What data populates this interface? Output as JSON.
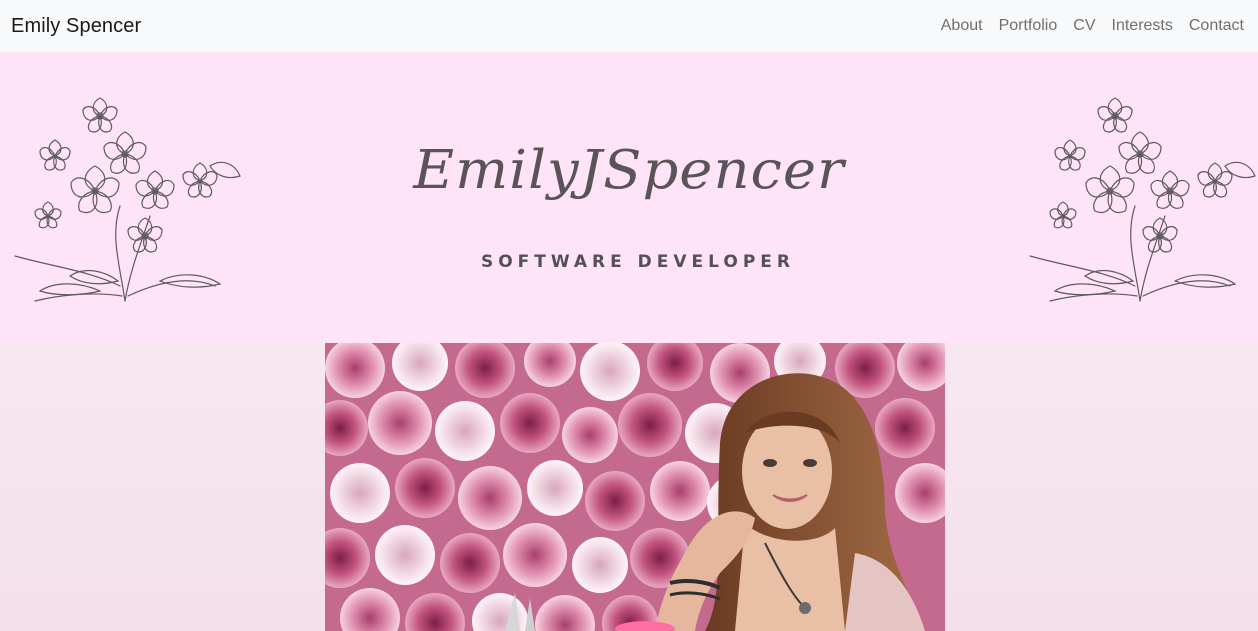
{
  "navbar": {
    "brand": "Emily Spencer",
    "links": [
      "About",
      "Portfolio",
      "CV",
      "Interests",
      "Contact"
    ]
  },
  "header": {
    "title": "EmilyJSpencer",
    "subtitle": "SOFTWARE DEVELOPER"
  },
  "colors": {
    "navbar_bg": "#f8f9fa",
    "banner_bg": "#ffe4f8",
    "page_bg": "#f7e6ee",
    "text_dark": "#5a5458"
  },
  "icons": {
    "left_decoration": "flower-bouquet-line-art",
    "right_decoration": "flower-bouquet-line-art"
  }
}
